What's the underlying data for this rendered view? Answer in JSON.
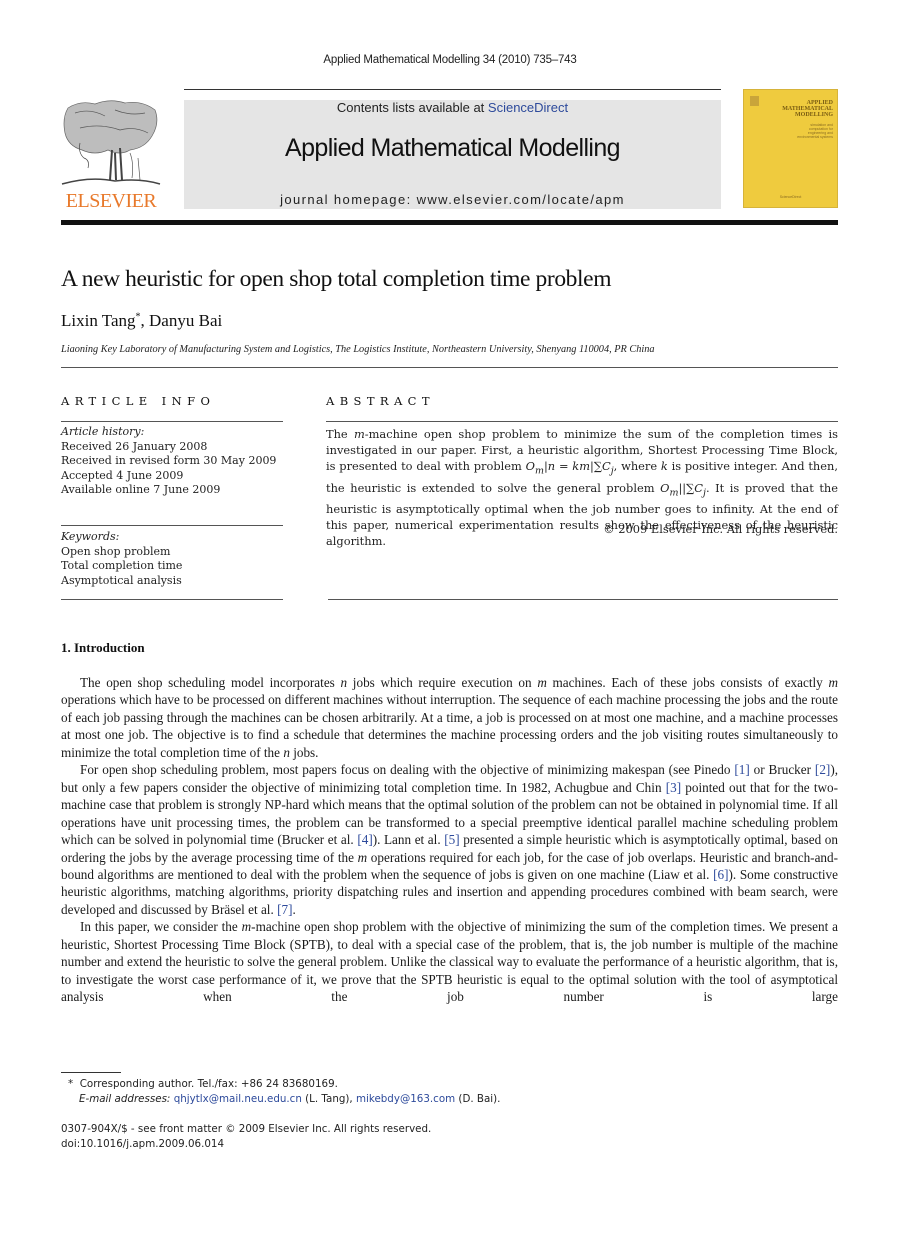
{
  "running_head": "Applied Mathematical Modelling 34 (2010) 735–743",
  "publisher": {
    "name": "ELSEVIER",
    "logo_icon": "elsevier-tree-icon",
    "brand_color": "#e8792b"
  },
  "banner": {
    "contents_prefix": "Contents lists available at ",
    "contents_link": "ScienceDirect",
    "journal_title": "Applied Mathematical Modelling",
    "homepage": "journal homepage: www.elsevier.com/locate/apm",
    "link_color": "#2d4a9b"
  },
  "cover": {
    "title_lines": [
      "APPLIED",
      "MATHEMATICAL",
      "MODELLING"
    ],
    "subtitle_lines": [
      "simulation and",
      "computation for",
      "engineering and",
      "environmental systems"
    ],
    "footer": "ScienceDirect",
    "color": "#efcb3e"
  },
  "article": {
    "title": "A new heuristic for open shop total completion time problem",
    "authors": [
      {
        "name": "Lixin Tang",
        "mark": "*"
      },
      {
        "name": "Danyu Bai",
        "mark": ""
      }
    ],
    "author_separator": ", ",
    "affiliation": "Liaoning Key Laboratory of Manufacturing System and Logistics, The Logistics Institute, Northeastern University, Shenyang 110004, PR China"
  },
  "article_info": {
    "heading": "ARTICLE INFO",
    "history_label": "Article history:",
    "history": [
      "Received 26 January 2008",
      "Received in revised form 30 May 2009",
      "Accepted 4 June 2009",
      "Available online 7 June 2009"
    ],
    "keywords_label": "Keywords:",
    "keywords": [
      "Open shop problem",
      "Total completion time",
      "Asymptotical analysis"
    ]
  },
  "abstract": {
    "heading": "ABSTRACT",
    "parts": {
      "p1": "The ",
      "m": "m",
      "p2": "-machine open shop problem to minimize the sum of the completion times is investigated in our paper. First, a heuristic algorithm, Shortest Processing Time Block, is presented to deal with problem ",
      "f1": "O",
      "f1_sub": "m",
      "f1_rest": "|n = km|∑C",
      "f1_sub2": "j",
      "p3": ", where ",
      "k": "k",
      "p4": " is positive integer. And then, the heuristic is extended to solve the general problem ",
      "f2": "O",
      "f2_sub": "m",
      "f2_rest": "||∑C",
      "f2_sub2": "j",
      "p5": ". It is proved that the heuristic is asymptotically optimal when the job number goes to infinity. At the end of this paper, numerical experimentation results show the effectiveness of the heuristic algorithm."
    },
    "copyright": "© 2009 Elsevier Inc. All rights reserved."
  },
  "section1": {
    "heading": "1.  Introduction",
    "para1": {
      "a": "The open shop scheduling model incorporates ",
      "n": "n",
      "b": " jobs which require execution on ",
      "m": "m",
      "c": " machines. Each of these jobs consists of exactly ",
      "m2": "m",
      "d": " operations which have to be processed on different machines without interruption. The sequence of each machine processing the jobs and the route of each job passing through the machines can be chosen arbitrarily. At a time, a job is processed on at most one machine, and a machine processes at most one job. The objective is to find a schedule that determines the machine processing orders and the job visiting routes simultaneously to minimize the total completion time of the ",
      "n2": "n",
      "e": " jobs."
    },
    "para2": {
      "a": "For open shop scheduling problem, most papers focus on dealing with the objective of minimizing makespan (see Pinedo ",
      "c1": "[1]",
      "b": " or Brucker ",
      "c2": "[2]",
      "c": "), but only a few papers consider the objective of minimizing total completion time. In 1982, Achugbue and Chin ",
      "c3": "[3]",
      "d": " pointed out that for the two-machine case that problem is strongly NP-hard which means that the optimal solution of the problem can not be obtained in polynomial time. If all operations have unit processing times, the problem can be transformed to a special preemptive identical parallel machine scheduling problem which can be solved in polynomial time (Brucker et al. ",
      "c4": "[4]",
      "e": "). Lann et al. ",
      "c5": "[5]",
      "f": " presented a simple heuristic which is asymptotically optimal, based on ordering the jobs by the average processing time of the ",
      "m": "m",
      "g": " operations required for each job, for the case of job overlaps. Heuristic and branch-and-bound algorithms are mentioned to deal with the problem when the sequence of jobs is given on one machine (Liaw et al. ",
      "c6": "[6]",
      "h": "). Some constructive heuristic algorithms, matching algorithms, priority dispatching rules and insertion and appending procedures combined with beam search, were developed and discussed by Bräsel et al. ",
      "c7": "[7]",
      "i": "."
    },
    "para3": {
      "a": "In this paper, we consider the ",
      "m": "m",
      "b": "-machine open shop problem with the objective of minimizing the sum of the completion times. We present a heuristic, Shortest Processing Time Block (SPTB), to deal with a special case of the problem, that is, the job number is multiple of the machine number and extend the heuristic to solve the general problem. Unlike the classical way to evaluate the performance of a heuristic algorithm, that is, to investigate the worst case performance of it, we prove that the SPTB heuristic is equal to the optimal solution with the tool of asymptotical analysis when the job number is large"
    }
  },
  "footnote": {
    "mark": "*",
    "corresponding": "Corresponding author. Tel./fax: +86 24 83680169.",
    "email_label": "E-mail addresses:",
    "email1": "qhjytlx@mail.neu.edu.cn",
    "email1_owner": " (L. Tang), ",
    "email2": "mikebdy@163.com",
    "email2_owner": " (D. Bai)."
  },
  "front_matter": {
    "issn_line": "0307-904X/$ - see front matter © 2009 Elsevier Inc. All rights reserved.",
    "doi": "doi:10.1016/j.apm.2009.06.014"
  }
}
